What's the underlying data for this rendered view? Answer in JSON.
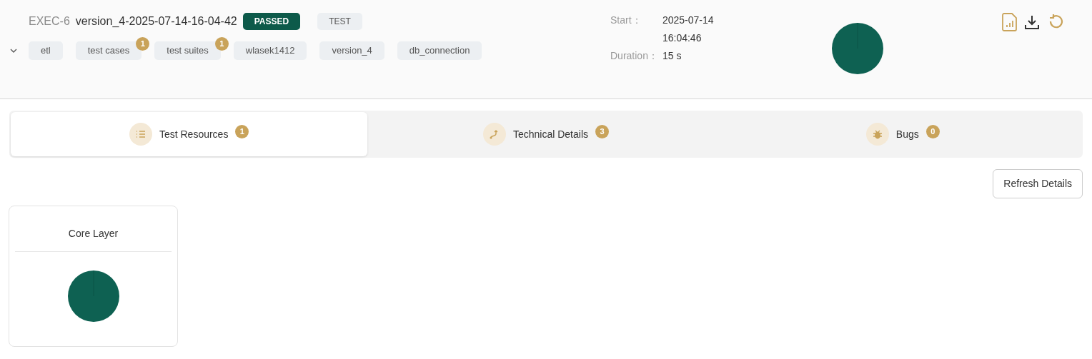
{
  "execution": {
    "id": "EXEC-6",
    "name": "version_4-2025-07-14-16-04-42",
    "status": "PASSED",
    "environment": "TEST",
    "expanded": false,
    "tags": [
      {
        "label": "etl"
      },
      {
        "label": "test cases",
        "count": "1"
      },
      {
        "label": "test suites",
        "count": "1"
      },
      {
        "label": "wlasek1412"
      },
      {
        "label": "version_4"
      },
      {
        "label": "db_connection"
      }
    ],
    "start_label": "Start：",
    "start_date": "2025-07-14",
    "start_time": "16:04:46",
    "duration_label": "Duration：",
    "duration": "15 s"
  },
  "tabs": [
    {
      "label": "Test Resources",
      "count": "1",
      "kind": "list",
      "selected": true
    },
    {
      "label": "Technical Details",
      "count": "3",
      "kind": "route",
      "selected": false
    },
    {
      "label": "Bugs",
      "count": "0",
      "kind": "bug",
      "selected": false
    }
  ],
  "refresh_button": "Refresh Details",
  "cards": [
    {
      "title": "Core Layer"
    }
  ]
}
